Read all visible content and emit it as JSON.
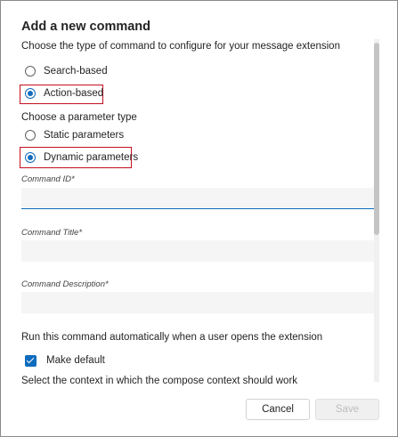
{
  "dialog": {
    "title": "Add a new command"
  },
  "command_type": {
    "heading": "Choose the type of command to configure for your message extension",
    "options": [
      {
        "label": "Search-based",
        "selected": false
      },
      {
        "label": "Action-based",
        "selected": true
      }
    ]
  },
  "parameter_type": {
    "heading": "Choose a parameter type",
    "options": [
      {
        "label": "Static parameters",
        "selected": false
      },
      {
        "label": "Dynamic parameters",
        "selected": true
      }
    ]
  },
  "fields": {
    "command_id": {
      "label": "Command ID*",
      "value": "",
      "placeholder": ""
    },
    "command_title": {
      "label": "Command Title*",
      "value": "",
      "placeholder": ""
    },
    "command_description": {
      "label": "Command Description*",
      "value": "",
      "placeholder": ""
    }
  },
  "auto_run": {
    "text": "Run this command automatically when a user opens the extension",
    "checkbox_label": "Make default",
    "checked": true
  },
  "context": {
    "text": "Select the context in which the compose context should work"
  },
  "footer": {
    "cancel_label": "Cancel",
    "save_label": "Save"
  },
  "colors": {
    "accent": "#0f6cbd",
    "highlight": "#c50f1f"
  }
}
